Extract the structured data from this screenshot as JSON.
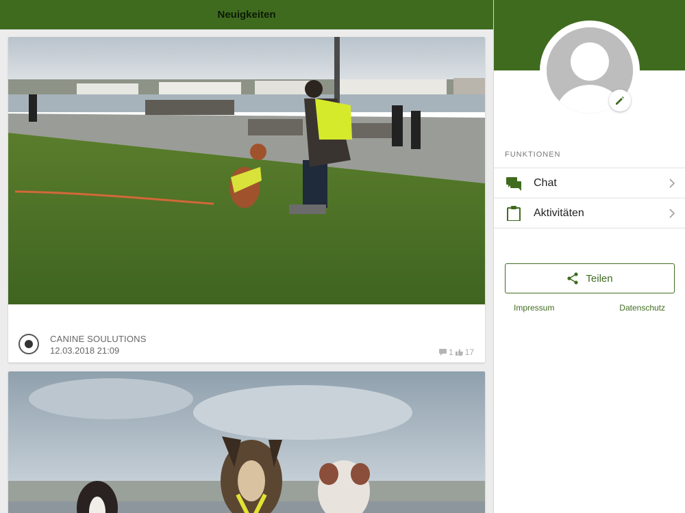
{
  "feed": {
    "title": "Neuigkeiten",
    "posts": [
      {
        "author": "CANINE SOULUTIONS",
        "date": "12.03.2018 21:09",
        "comments": "1",
        "likes": "17"
      }
    ]
  },
  "sidebar": {
    "section_label": "FUNKTIONEN",
    "items": [
      {
        "label": "Chat",
        "icon": "chat-icon"
      },
      {
        "label": "Aktivitäten",
        "icon": "clipboard-icon"
      }
    ],
    "share_label": "Teilen",
    "links": {
      "impressum": "Impressum",
      "datenschutz": "Datenschutz"
    }
  },
  "colors": {
    "brand_green": "#3f6b1f",
    "background": "#ececec"
  }
}
